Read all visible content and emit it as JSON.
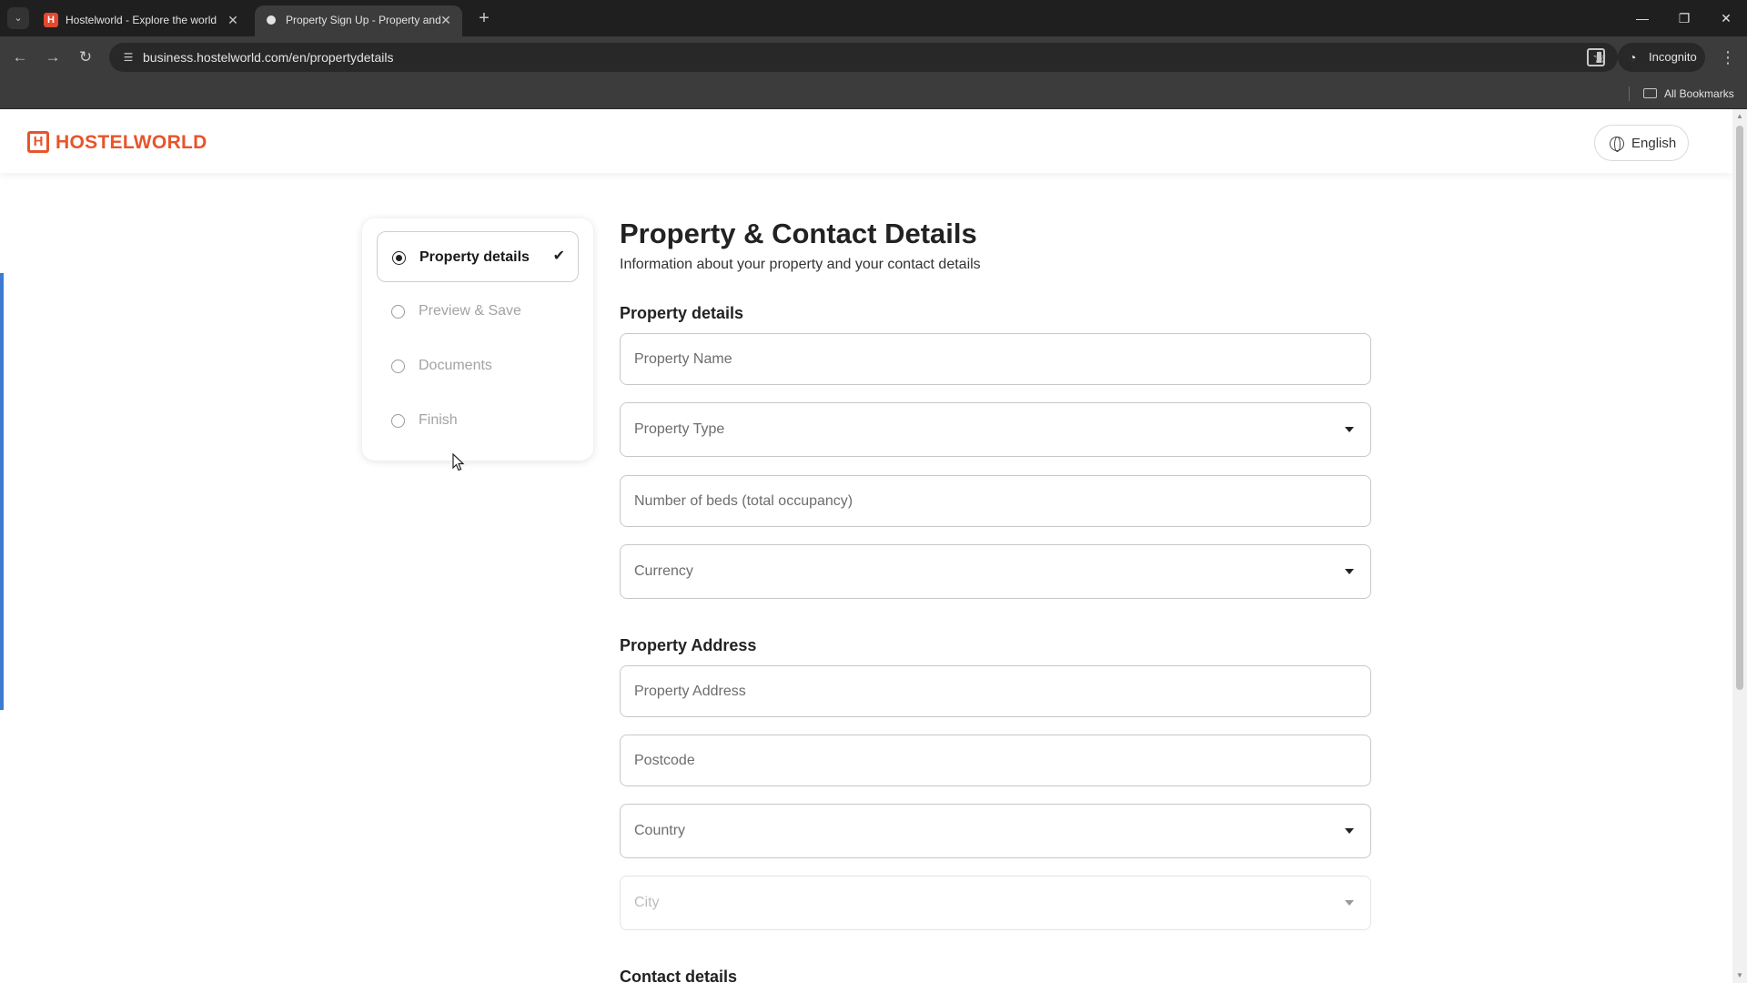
{
  "browser": {
    "tabs": [
      {
        "title": "Hostelworld - Explore the world",
        "favicon": "hostelworld-favicon"
      },
      {
        "title": "Property Sign Up - Property and",
        "favicon": "loading-dot"
      }
    ],
    "url": "business.hostelworld.com/en/propertydetails",
    "incognito_label": "Incognito",
    "bookmarks_label": "All Bookmarks"
  },
  "header": {
    "logo_text": "HOSTELWORLD",
    "logo_color": "#e8542b",
    "language_label": "English"
  },
  "stepper": {
    "steps": [
      {
        "label": "Property details",
        "state": "active",
        "completed": true
      },
      {
        "label": "Preview & Save",
        "state": "pending"
      },
      {
        "label": "Documents",
        "state": "pending"
      },
      {
        "label": "Finish",
        "state": "pending"
      }
    ]
  },
  "form": {
    "title": "Property & Contact Details",
    "subtitle": "Information about your property and your contact details",
    "sections": {
      "property_details": {
        "heading": "Property details",
        "property_name_placeholder": "Property Name",
        "property_type_placeholder": "Property Type",
        "beds_placeholder": "Number of beds (total occupancy)",
        "currency_placeholder": "Currency"
      },
      "property_address": {
        "heading": "Property Address",
        "address_placeholder": "Property Address",
        "postcode_placeholder": "Postcode",
        "country_placeholder": "Country",
        "city_placeholder": "City"
      },
      "contact_details": {
        "heading": "Contact details"
      }
    }
  },
  "accent_color": "#3d7bd1"
}
